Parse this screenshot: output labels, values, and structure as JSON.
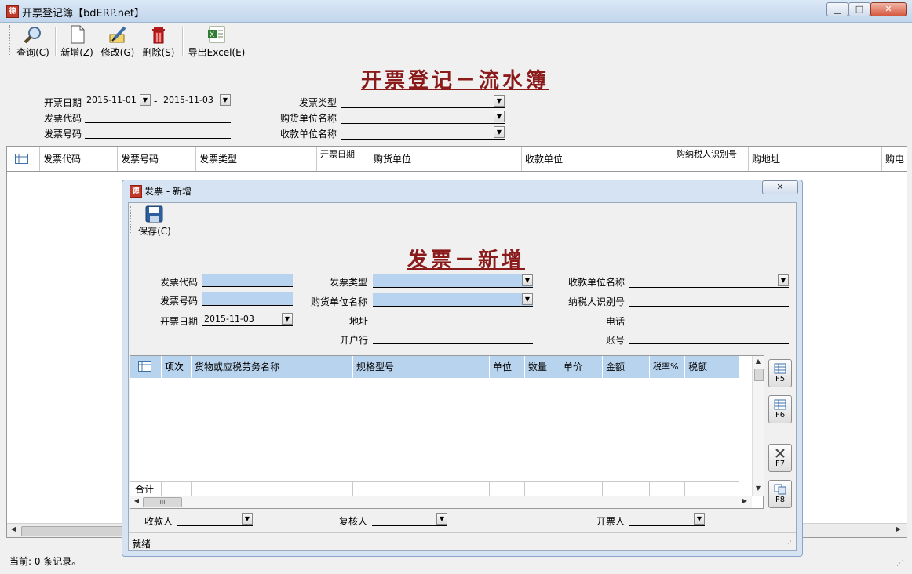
{
  "window": {
    "title": "开票登记簿【bdERP.net】",
    "app_icon_text": "德",
    "controls": [
      "▁",
      "□",
      "✕"
    ]
  },
  "toolbar": [
    {
      "label": "查询(C)",
      "icon": "magnifier-icon"
    },
    {
      "label": "新增(Z)",
      "icon": "new-document-icon"
    },
    {
      "label": "修改(G)",
      "icon": "edit-pencil-icon"
    },
    {
      "label": "删除(S)",
      "icon": "trash-icon"
    },
    {
      "label": "导出Excel(E)",
      "icon": "excel-icon"
    }
  ],
  "page_title": "开票登记－流水簿",
  "filters": {
    "date_label": "开票日期",
    "date_from": "2015-11-01",
    "date_sep": "-",
    "date_to": "2015-11-03",
    "invoice_code_label": "发票代码",
    "invoice_no_label": "发票号码",
    "invoice_type_label": "发票类型",
    "buyer_label": "购货单位名称",
    "payee_unit_label": "收款单位名称"
  },
  "main_grid": {
    "columns": [
      "发票代码",
      "发票号码",
      "发票类型",
      "开票日期",
      "购货单位",
      "收款单位",
      "购纳税人识别号",
      "购地址",
      "购电"
    ]
  },
  "status_bar": {
    "text": "当前: 0 条记录。"
  },
  "dialog": {
    "title": "发票 - 新增",
    "close": "✕",
    "save_label": "保存(C)",
    "heading": "发票－新增",
    "fields": {
      "invoice_code": "发票代码",
      "invoice_no": "发票号码",
      "invoice_date": "开票日期",
      "invoice_date_value": "2015-11-03",
      "invoice_type": "发票类型",
      "buyer_name": "购货单位名称",
      "address": "地址",
      "bank": "开户行",
      "payee_unit": "收款单位名称",
      "taxpayer_id": "纳税人识别号",
      "phone": "电话",
      "account": "账号"
    },
    "grid": {
      "columns": [
        "项次",
        "货物或应税劳务名称",
        "规格型号",
        "单位",
        "数量",
        "单价",
        "金额",
        "税率%",
        "税额"
      ],
      "total_label": "合计"
    },
    "side_buttons": [
      "F5",
      "F6",
      "F7",
      "F8"
    ],
    "footer": {
      "payee": "收款人",
      "reviewer": "复核人",
      "drawer": "开票人"
    },
    "status": "就绪",
    "scroll_thumb": "III"
  }
}
